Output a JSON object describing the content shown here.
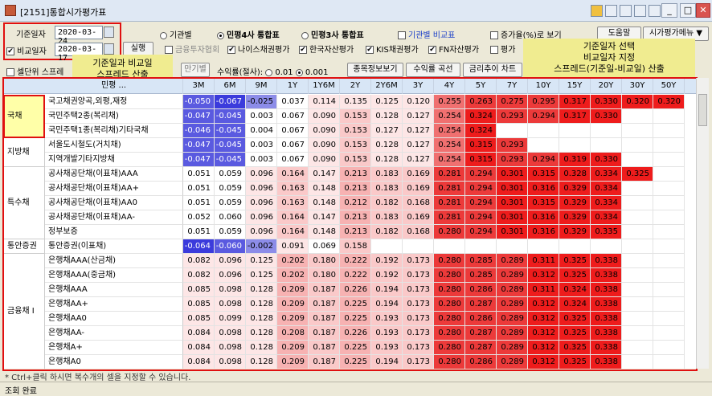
{
  "window": {
    "title": "[2151]통합시가평가표",
    "minimize": "_",
    "maximize": "□",
    "close": "✕"
  },
  "filters": {
    "base_date_label": "기준일자",
    "base_date": "2020-03-24",
    "compare_date_label": "비교일자",
    "compare_date": "2020-03-17",
    "compare_checked": true,
    "run_label": "실행"
  },
  "view_options": {
    "by_institution": "기관별",
    "minpyung4": "민평4사 통합표",
    "minpyung3": "민평3사 통합표",
    "compare_table": "기관별 비교표",
    "finance_assoc": "금융투자협회",
    "nice": "나이스채권평가",
    "korea_assess": "한국자산평가",
    "kis": "KIS채권평가",
    "fn": "FN자산평가",
    "rate_view": "증가율(%)로 보기",
    "avg_label": "평가"
  },
  "menu": {
    "help": "도움말",
    "eval_menu": "시가평가메뉴 ▼"
  },
  "row2": {
    "spread_cb": "셀단위 스프레",
    "maturity_btn": "만기별",
    "yield_label": "수익률(절사):",
    "opt1": "0.01",
    "opt2": "0.001",
    "detail_btn": "종목정보보기",
    "curve_btn": "수익률 곡선",
    "trend_btn": "금리추이 차트"
  },
  "annotations": {
    "left_line1": "기준일과 비교일",
    "left_line2": "스프레드 산출",
    "right_line1": "기준일자 선택",
    "right_line2": "비교일자 지정",
    "right_line3": "스프레드(기준일-비교일) 산출"
  },
  "table": {
    "name_header": "민평 ...",
    "columns": [
      "3M",
      "6M",
      "9M",
      "1Y",
      "1Y6M",
      "2Y",
      "2Y6M",
      "3Y",
      "4Y",
      "5Y",
      "7Y",
      "10Y",
      "15Y",
      "20Y",
      "30Y",
      "50Y"
    ],
    "groups": [
      {
        "label": "국채",
        "start": 0,
        "span": 3,
        "selected": true
      },
      {
        "label": "지방채",
        "start": 3,
        "span": 2,
        "selected": false
      },
      {
        "label": "특수채",
        "start": 5,
        "span": 5,
        "selected": false
      },
      {
        "label": "통안증권",
        "start": 10,
        "span": 1,
        "selected": false
      },
      {
        "label": "금융채 I",
        "start": 11,
        "span": 8,
        "selected": false
      }
    ],
    "rows": [
      {
        "name": "국고채권양곡,외평,재정",
        "values": [
          "-0.050",
          "-0.067",
          "-0.025",
          "0.037",
          "0.114",
          "0.135",
          "0.125",
          "0.120",
          "0.255",
          "0.263",
          "0.275",
          "0.295",
          "0.317",
          "0.330",
          "0.320",
          "0.320"
        ]
      },
      {
        "name": "국민주택2종(복리채)",
        "values": [
          "-0.047",
          "-0.045",
          "0.003",
          "0.067",
          "0.090",
          "0.153",
          "0.128",
          "0.127",
          "0.254",
          "0.324",
          "0.293",
          "0.294",
          "0.317",
          "0.330",
          "",
          ""
        ]
      },
      {
        "name": "국민주택1종(복리채)기타국채",
        "values": [
          "-0.046",
          "-0.045",
          "0.004",
          "0.067",
          "0.090",
          "0.153",
          "0.127",
          "0.127",
          "0.254",
          "0.324",
          "",
          "",
          "",
          "",
          "",
          ""
        ]
      },
      {
        "name": "서울도시철도(거치채)",
        "values": [
          "-0.047",
          "-0.045",
          "0.003",
          "0.067",
          "0.090",
          "0.153",
          "0.128",
          "0.127",
          "0.254",
          "0.315",
          "0.293",
          "",
          "",
          "",
          "",
          ""
        ]
      },
      {
        "name": "지역개발기타지방채",
        "values": [
          "-0.047",
          "-0.045",
          "0.003",
          "0.067",
          "0.090",
          "0.153",
          "0.128",
          "0.127",
          "0.254",
          "0.315",
          "0.293",
          "0.294",
          "0.319",
          "0.330",
          "",
          ""
        ]
      },
      {
        "name": "공사채공단채(이표채)AAA",
        "values": [
          "0.051",
          "0.059",
          "0.096",
          "0.164",
          "0.147",
          "0.213",
          "0.183",
          "0.169",
          "0.281",
          "0.294",
          "0.301",
          "0.315",
          "0.328",
          "0.334",
          "0.325",
          ""
        ]
      },
      {
        "name": "공사채공단채(이표채)AA+",
        "values": [
          "0.051",
          "0.059",
          "0.096",
          "0.163",
          "0.148",
          "0.213",
          "0.183",
          "0.169",
          "0.281",
          "0.294",
          "0.301",
          "0.316",
          "0.329",
          "0.334",
          "",
          ""
        ]
      },
      {
        "name": "공사채공단채(이표채)AA0",
        "values": [
          "0.051",
          "0.059",
          "0.096",
          "0.163",
          "0.148",
          "0.212",
          "0.182",
          "0.168",
          "0.281",
          "0.294",
          "0.301",
          "0.315",
          "0.329",
          "0.334",
          "",
          ""
        ]
      },
      {
        "name": "공사채공단채(이표채)AA-",
        "values": [
          "0.052",
          "0.060",
          "0.096",
          "0.164",
          "0.147",
          "0.213",
          "0.183",
          "0.169",
          "0.281",
          "0.294",
          "0.301",
          "0.316",
          "0.329",
          "0.334",
          "",
          ""
        ]
      },
      {
        "name": "정부보증",
        "values": [
          "0.051",
          "0.059",
          "0.096",
          "0.164",
          "0.148",
          "0.213",
          "0.182",
          "0.168",
          "0.280",
          "0.294",
          "0.301",
          "0.316",
          "0.329",
          "0.335",
          "",
          ""
        ]
      },
      {
        "name": "통안증권(이표채)",
        "values": [
          "-0.064",
          "-0.060",
          "-0.002",
          "0.091",
          "0.069",
          "0.158",
          "",
          "",
          "",
          "",
          "",
          "",
          "",
          "",
          "",
          ""
        ]
      },
      {
        "name": "은행채AAA(산금채)",
        "values": [
          "0.082",
          "0.096",
          "0.125",
          "0.202",
          "0.180",
          "0.222",
          "0.192",
          "0.173",
          "0.280",
          "0.285",
          "0.289",
          "0.311",
          "0.325",
          "0.338",
          "",
          ""
        ]
      },
      {
        "name": "은행채AAA(중금채)",
        "values": [
          "0.082",
          "0.096",
          "0.125",
          "0.202",
          "0.180",
          "0.222",
          "0.192",
          "0.173",
          "0.280",
          "0.285",
          "0.289",
          "0.312",
          "0.325",
          "0.338",
          "",
          ""
        ]
      },
      {
        "name": "은행채AAA",
        "values": [
          "0.085",
          "0.098",
          "0.128",
          "0.209",
          "0.187",
          "0.226",
          "0.194",
          "0.173",
          "0.280",
          "0.286",
          "0.289",
          "0.311",
          "0.324",
          "0.338",
          "",
          ""
        ]
      },
      {
        "name": "은행채AA+",
        "values": [
          "0.085",
          "0.098",
          "0.128",
          "0.209",
          "0.187",
          "0.225",
          "0.194",
          "0.173",
          "0.280",
          "0.287",
          "0.289",
          "0.312",
          "0.324",
          "0.338",
          "",
          ""
        ]
      },
      {
        "name": "은행채AA0",
        "values": [
          "0.085",
          "0.099",
          "0.128",
          "0.209",
          "0.187",
          "0.225",
          "0.193",
          "0.173",
          "0.280",
          "0.286",
          "0.289",
          "0.312",
          "0.325",
          "0.338",
          "",
          ""
        ]
      },
      {
        "name": "은행채AA-",
        "values": [
          "0.084",
          "0.098",
          "0.128",
          "0.208",
          "0.187",
          "0.226",
          "0.193",
          "0.173",
          "0.280",
          "0.287",
          "0.289",
          "0.312",
          "0.325",
          "0.338",
          "",
          ""
        ]
      },
      {
        "name": "은행채A+",
        "values": [
          "0.084",
          "0.098",
          "0.128",
          "0.209",
          "0.187",
          "0.225",
          "0.193",
          "0.173",
          "0.280",
          "0.287",
          "0.289",
          "0.312",
          "0.325",
          "0.338",
          "",
          ""
        ]
      },
      {
        "name": "은행채A0",
        "values": [
          "0.084",
          "0.098",
          "0.128",
          "0.209",
          "0.187",
          "0.225",
          "0.194",
          "0.173",
          "0.280",
          "0.286",
          "0.289",
          "0.312",
          "0.325",
          "0.338",
          "",
          ""
        ]
      }
    ]
  },
  "note": "* Ctrl+클릭 하시면 복수개의 셀을 지정할 수 있습니다.",
  "status": "조회 완료",
  "colors": {
    "neg_strong": "#3b3bdc",
    "neg_weak": "#8c8ce8",
    "pos_light": "#fde6e6",
    "pos_mid": "#f7b2b2",
    "pos_deep": "#f07070",
    "pos_strong": "#ee1c1c",
    "annotation_bg": "#f0ec90",
    "highlight_box": "#e01010"
  }
}
